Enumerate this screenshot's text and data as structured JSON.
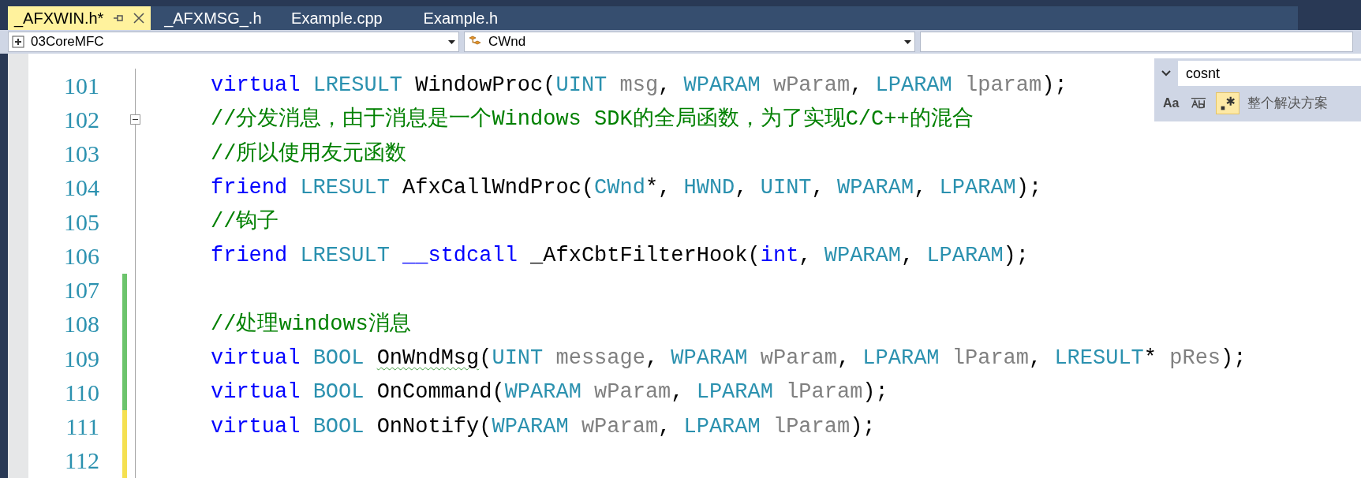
{
  "tabs": [
    {
      "label": "_AFXWIN.h*",
      "selected": true,
      "pinned": true,
      "closable": true
    },
    {
      "label": "_AFXMSG_.h",
      "selected": false,
      "pinned": false,
      "closable": false
    },
    {
      "label": "Example.cpp",
      "selected": false,
      "pinned": false,
      "closable": false
    },
    {
      "label": "Example.h",
      "selected": false,
      "pinned": false,
      "closable": false
    }
  ],
  "navigation": {
    "project": "03CoreMFC",
    "scope": "CWnd"
  },
  "lines": [
    {
      "number": "101",
      "fold": false,
      "tokens": [
        {
          "kind": "keyword",
          "text": "virtual "
        },
        {
          "kind": "type",
          "text": "LRESULT"
        },
        {
          "kind": "plain",
          "text": " WindowProc("
        },
        {
          "kind": "type",
          "text": "UINT "
        },
        {
          "kind": "param",
          "text": "msg"
        },
        {
          "kind": "plain",
          "text": ", "
        },
        {
          "kind": "type",
          "text": "WPARAM "
        },
        {
          "kind": "param",
          "text": "wParam"
        },
        {
          "kind": "plain",
          "text": ", "
        },
        {
          "kind": "type",
          "text": "LPARAM "
        },
        {
          "kind": "param",
          "text": "lparam"
        },
        {
          "kind": "plain",
          "text": ");"
        }
      ]
    },
    {
      "number": "102",
      "fold": true,
      "tokens": [
        {
          "kind": "comment",
          "text": "//分发消息，由于消息是一个Windows SDK的全局函数，为了实现C/C++的混合"
        }
      ]
    },
    {
      "number": "103",
      "fold": false,
      "tokens": [
        {
          "kind": "comment",
          "text": "//所以使用友元函数"
        }
      ]
    },
    {
      "number": "104",
      "fold": false,
      "tokens": [
        {
          "kind": "keyword",
          "text": "friend "
        },
        {
          "kind": "type",
          "text": "LRESULT"
        },
        {
          "kind": "plain",
          "text": " AfxCallWndProc("
        },
        {
          "kind": "type",
          "text": "CWnd"
        },
        {
          "kind": "plain",
          "text": "*, "
        },
        {
          "kind": "type",
          "text": "HWND"
        },
        {
          "kind": "plain",
          "text": ", "
        },
        {
          "kind": "type",
          "text": "UINT"
        },
        {
          "kind": "plain",
          "text": ", "
        },
        {
          "kind": "type",
          "text": "WPARAM"
        },
        {
          "kind": "plain",
          "text": ", "
        },
        {
          "kind": "type",
          "text": "LPARAM"
        },
        {
          "kind": "plain",
          "text": ");"
        }
      ]
    },
    {
      "number": "105",
      "fold": false,
      "tokens": [
        {
          "kind": "comment",
          "text": "//钩子"
        }
      ]
    },
    {
      "number": "106",
      "fold": false,
      "tokens": [
        {
          "kind": "keyword",
          "text": "friend "
        },
        {
          "kind": "type",
          "text": "LRESULT "
        },
        {
          "kind": "keyword",
          "text": "__stdcall"
        },
        {
          "kind": "plain",
          "text": " _AfxCbtFilterHook("
        },
        {
          "kind": "keyword",
          "text": "int"
        },
        {
          "kind": "plain",
          "text": ", "
        },
        {
          "kind": "type",
          "text": "WPARAM"
        },
        {
          "kind": "plain",
          "text": ", "
        },
        {
          "kind": "type",
          "text": "LPARAM"
        },
        {
          "kind": "plain",
          "text": ");"
        }
      ]
    },
    {
      "number": "107",
      "fold": false,
      "color": "#6cc46c"
    },
    {
      "number": "108",
      "fold": false,
      "color": "#6cc46c",
      "tokens": [
        {
          "kind": "comment",
          "text": "//处理windows消息"
        }
      ]
    },
    {
      "number": "109",
      "fold": false,
      "color": "#6cc46c",
      "tokens": [
        {
          "kind": "keyword",
          "text": "virtual "
        },
        {
          "kind": "type",
          "text": "BOOL "
        },
        {
          "kind": "squiggle",
          "text": "OnWndMsg"
        },
        {
          "kind": "plain",
          "text": "("
        },
        {
          "kind": "type",
          "text": "UINT "
        },
        {
          "kind": "param",
          "text": "message"
        },
        {
          "kind": "plain",
          "text": ", "
        },
        {
          "kind": "type",
          "text": "WPARAM "
        },
        {
          "kind": "param",
          "text": "wParam"
        },
        {
          "kind": "plain",
          "text": ", "
        },
        {
          "kind": "type",
          "text": "LPARAM "
        },
        {
          "kind": "param",
          "text": "lParam"
        },
        {
          "kind": "plain",
          "text": ", "
        },
        {
          "kind": "type",
          "text": "LRESULT"
        },
        {
          "kind": "plain",
          "text": "* "
        },
        {
          "kind": "param",
          "text": "pRes"
        },
        {
          "kind": "plain",
          "text": ");"
        }
      ]
    },
    {
      "number": "110",
      "fold": false,
      "color": "#6cc46c",
      "tokens": [
        {
          "kind": "keyword",
          "text": "virtual "
        },
        {
          "kind": "type",
          "text": "BOOL"
        },
        {
          "kind": "plain",
          "text": " OnCommand("
        },
        {
          "kind": "type",
          "text": "WPARAM "
        },
        {
          "kind": "param",
          "text": "wParam"
        },
        {
          "kind": "plain",
          "text": ", "
        },
        {
          "kind": "type",
          "text": "LPARAM "
        },
        {
          "kind": "param",
          "text": "lParam"
        },
        {
          "kind": "plain",
          "text": ");"
        }
      ]
    },
    {
      "number": "111",
      "fold": false,
      "color": "#f5e050",
      "tokens": [
        {
          "kind": "keyword",
          "text": "virtual "
        },
        {
          "kind": "type",
          "text": "BOOL"
        },
        {
          "kind": "plain",
          "text": " OnNotify("
        },
        {
          "kind": "type",
          "text": "WPARAM "
        },
        {
          "kind": "param",
          "text": "wParam"
        },
        {
          "kind": "plain",
          "text": ", "
        },
        {
          "kind": "type",
          "text": "LPARAM "
        },
        {
          "kind": "param",
          "text": "lParam"
        },
        {
          "kind": "plain",
          "text": ");"
        }
      ]
    },
    {
      "number": "112",
      "fold": false,
      "color": "#f5e050"
    }
  ],
  "find": {
    "value": "cosnt",
    "match_case_label": "Aa",
    "match_case": false,
    "whole_word": false,
    "regex": true,
    "scope": "整个解决方案"
  }
}
